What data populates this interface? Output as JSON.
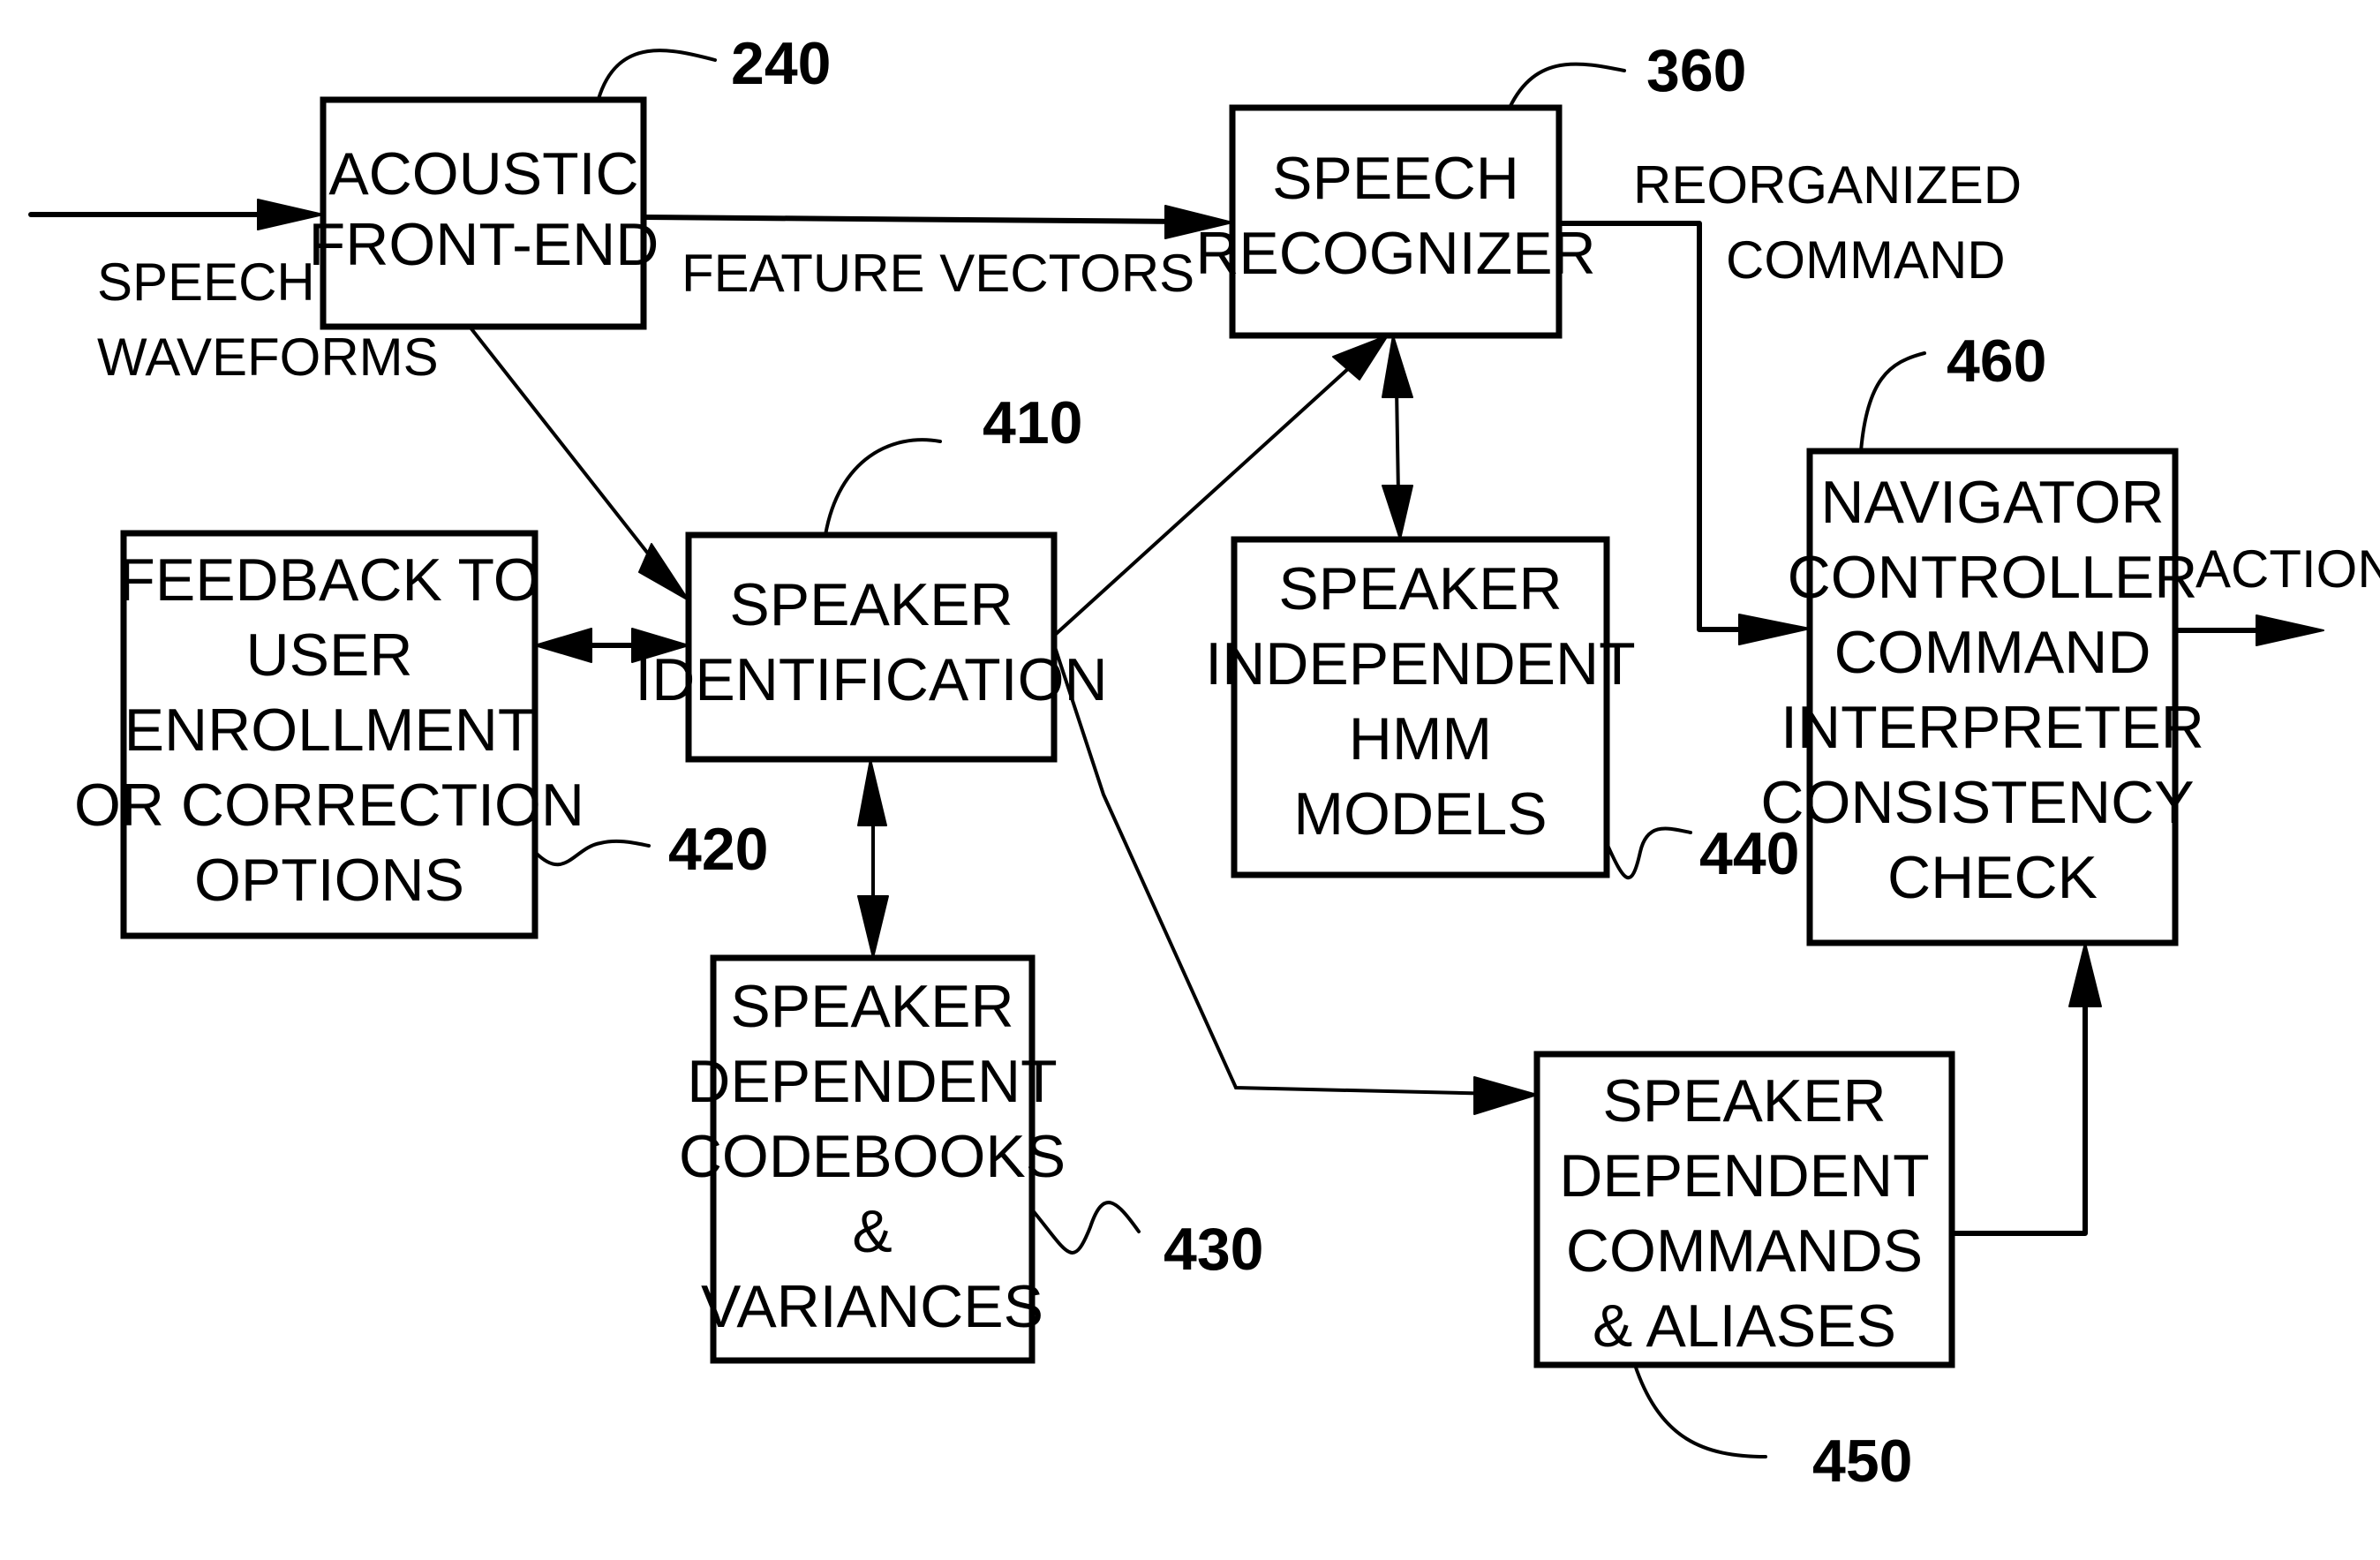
{
  "diagram": {
    "blocks": {
      "acoustic_front_end": {
        "ref": "240",
        "lines": [
          "ACOUSTIC",
          "FRONT-END"
        ]
      },
      "speech_recognizer": {
        "ref": "360",
        "lines": [
          "SPEECH",
          "RECOGNIZER"
        ]
      },
      "feedback": {
        "ref": "420",
        "lines": [
          "FEEDBACK TO",
          "USER",
          "ENROLLMENT",
          "OR CORRECTION",
          "OPTIONS"
        ]
      },
      "speaker_identification": {
        "ref": "410",
        "lines": [
          "SPEAKER",
          "IDENTIFICATION"
        ]
      },
      "si_hmm_models": {
        "ref": "440",
        "lines": [
          "SPEAKER",
          "INDEPENDENT",
          "HMM",
          "MODELS"
        ]
      },
      "navigator_controller": {
        "ref": "460",
        "lines": [
          "NAVIGATOR",
          "CONTROLLER",
          "COMMAND",
          "INTERPRETER",
          "CONSISTENCY",
          "CHECK"
        ]
      },
      "sd_codebooks": {
        "ref": "430",
        "lines": [
          "SPEAKER",
          "DEPENDENT",
          "CODEBOOKS",
          "&",
          "VARIANCES"
        ]
      },
      "sd_commands": {
        "ref": "450",
        "lines": [
          "SPEAKER",
          "DEPENDENT",
          "COMMANDS",
          "& ALIASES"
        ]
      }
    },
    "signal_labels": {
      "speech_waveforms": [
        "SPEECH",
        "WAVEFORMS"
      ],
      "feature_vectors": "FEATURE VECTORS",
      "reorganized_command": [
        "REORGANIZED",
        "COMMAND"
      ],
      "action": "ACTION"
    },
    "connections": [
      {
        "from": "input",
        "to": "acoustic_front_end",
        "label": "SPEECH WAVEFORMS",
        "direction": "forward"
      },
      {
        "from": "acoustic_front_end",
        "to": "speech_recognizer",
        "label": "FEATURE VECTORS",
        "direction": "forward"
      },
      {
        "from": "acoustic_front_end",
        "to": "speaker_identification",
        "direction": "forward"
      },
      {
        "from": "speaker_identification",
        "to": "speech_recognizer",
        "direction": "forward"
      },
      {
        "from": "speaker_identification",
        "to": "feedback",
        "direction": "bidirectional"
      },
      {
        "from": "speaker_identification",
        "to": "sd_codebooks",
        "direction": "bidirectional"
      },
      {
        "from": "speech_recognizer",
        "to": "si_hmm_models",
        "direction": "bidirectional"
      },
      {
        "from": "speaker_identification",
        "to": "sd_commands",
        "direction": "forward"
      },
      {
        "from": "speech_recognizer",
        "to": "navigator_controller",
        "label": "REORGANIZED COMMAND",
        "direction": "forward"
      },
      {
        "from": "sd_commands",
        "to": "navigator_controller",
        "direction": "forward"
      },
      {
        "from": "navigator_controller",
        "to": "output",
        "label": "ACTION",
        "direction": "forward"
      }
    ]
  }
}
